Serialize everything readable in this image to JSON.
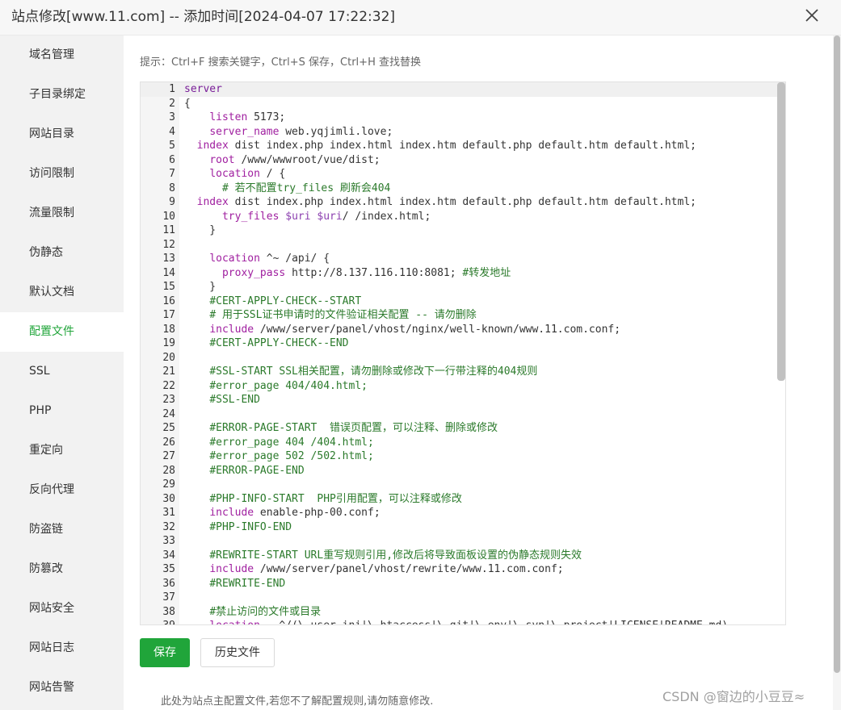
{
  "dialog": {
    "title": "站点修改[www.11.com] -- 添加时间[2024-04-07 17:22:32]",
    "close_icon": "close-icon"
  },
  "sidebar": {
    "active_color": "#20a53a",
    "items": [
      {
        "label": "域名管理"
      },
      {
        "label": "子目录绑定"
      },
      {
        "label": "网站目录"
      },
      {
        "label": "访问限制"
      },
      {
        "label": "流量限制"
      },
      {
        "label": "伪静态"
      },
      {
        "label": "默认文档"
      },
      {
        "label": "配置文件",
        "active": true
      },
      {
        "label": "SSL"
      },
      {
        "label": "PHP"
      },
      {
        "label": "重定向"
      },
      {
        "label": "反向代理"
      },
      {
        "label": "防盗链"
      },
      {
        "label": "防篡改"
      },
      {
        "label": "网站安全"
      },
      {
        "label": "网站日志"
      },
      {
        "label": "网站告警"
      }
    ]
  },
  "main": {
    "tip": "提示：Ctrl+F 搜索关键字，Ctrl+S 保存，Ctrl+H 查找替换",
    "editor": {
      "lines": [
        "server",
        "{",
        "    listen 5173;",
        "    server_name web.yqjimli.love;",
        "  index dist index.php index.html index.htm default.php default.htm default.html;",
        "    root /www/wwwroot/vue/dist;",
        "    location / {",
        "      # 若不配置try_files 刷新会404",
        "  index dist index.php index.html index.htm default.php default.htm default.html;",
        "      try_files $uri $uri/ /index.html;",
        "    }",
        "",
        "    location ^~ /api/ {",
        "      proxy_pass http://8.137.116.110:8081; #转发地址",
        "    }",
        "    #CERT-APPLY-CHECK--START",
        "    # 用于SSL证书申请时的文件验证相关配置 -- 请勿删除",
        "    include /www/server/panel/vhost/nginx/well-known/www.11.com.conf;",
        "    #CERT-APPLY-CHECK--END",
        "",
        "    #SSL-START SSL相关配置，请勿删除或修改下一行带注释的404规则",
        "    #error_page 404/404.html;",
        "    #SSL-END",
        "",
        "    #ERROR-PAGE-START  错误页配置，可以注释、删除或修改",
        "    #error_page 404 /404.html;",
        "    #error_page 502 /502.html;",
        "    #ERROR-PAGE-END",
        "",
        "    #PHP-INFO-START  PHP引用配置，可以注释或修改",
        "    include enable-php-00.conf;",
        "    #PHP-INFO-END",
        "",
        "    #REWRITE-START URL重写规则引用,修改后将导致面板设置的伪静态规则失效",
        "    include /www/server/panel/vhost/rewrite/www.11.com.conf;",
        "    #REWRITE-END",
        "",
        "    #禁止访问的文件或目录",
        "    location ~ ^/(\\.user.ini|\\.htaccess|\\.git|\\.env|\\.svn|\\.project|LICENSE|README.md)"
      ]
    },
    "save_label": "保存",
    "history_label": "历史文件",
    "note": "此处为站点主配置文件,若您不了解配置规则,请勿随意修改.",
    "accent": "#20a53a"
  },
  "watermark": "CSDN @窗边的小豆豆≈"
}
